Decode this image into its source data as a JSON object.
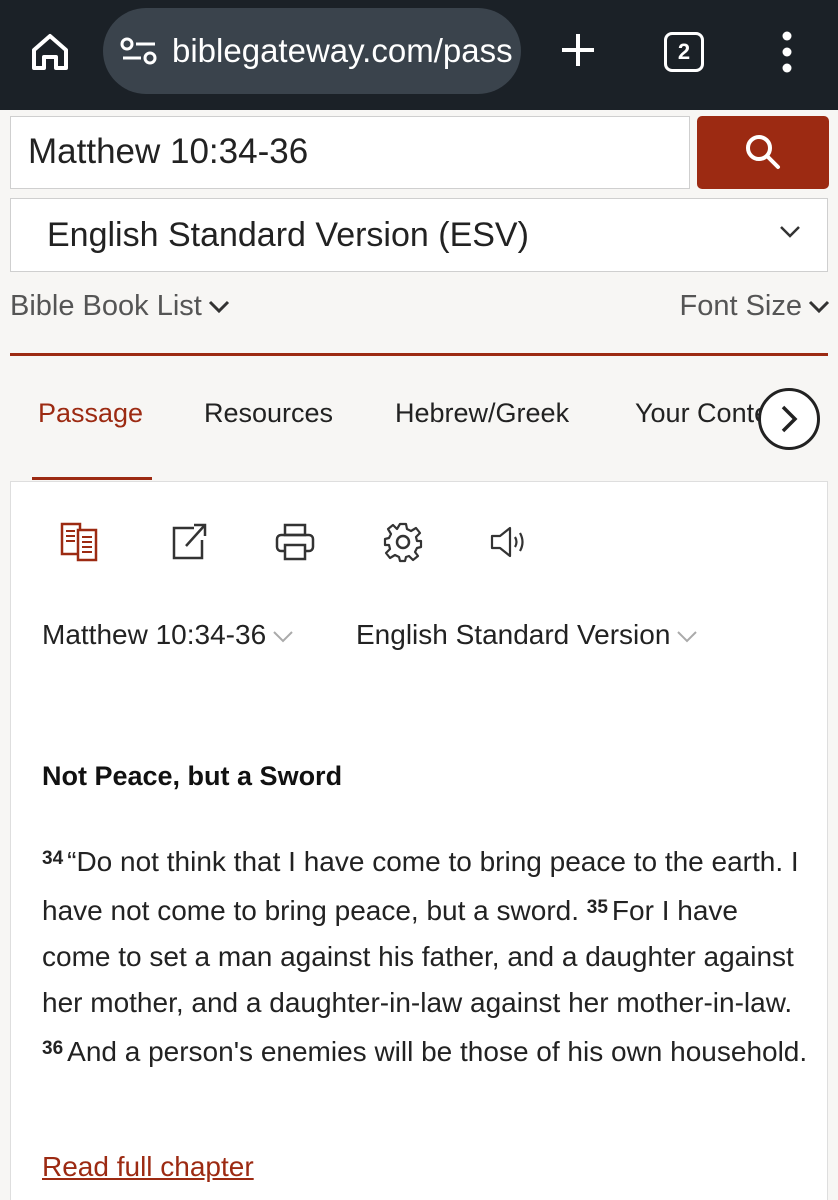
{
  "browser": {
    "url": "biblegateway.com/passage",
    "tab_count": "2",
    "icons": [
      "home-icon",
      "site-settings-icon",
      "plus-icon",
      "tab-switcher-icon",
      "more-menu-icon"
    ]
  },
  "search": {
    "query": "Matthew 10:34-36",
    "button_icon": "search-icon"
  },
  "version_select": {
    "selected": "English Standard Version (ESV)"
  },
  "nav": {
    "book_list_label": "Bible Book List",
    "font_size_label": "Font Size"
  },
  "tabs": [
    {
      "label": "Passage",
      "active": true
    },
    {
      "label": "Resources",
      "active": false
    },
    {
      "label": "Hebrew/Greek",
      "active": false
    },
    {
      "label": "Your Content",
      "active": false
    }
  ],
  "toolbar": {
    "icons": [
      "parallel-view-icon",
      "share-icon",
      "print-icon",
      "settings-icon",
      "audio-icon"
    ]
  },
  "passage_selector": {
    "reference": "Matthew 10:34-36",
    "version": "English Standard Version"
  },
  "passage": {
    "heading": "Not Peace, but a Sword",
    "verses": [
      {
        "num": "34",
        "text": "“Do not think that I have come to bring peace to the earth. I have not come to bring peace, but a sword."
      },
      {
        "num": "35",
        "text": "For I have come to set a man against his father, and a daughter against her mother, and a daughter-in-law against her mother-in-law."
      },
      {
        "num": "36",
        "text": "And a person's enemies will be those of his own household."
      }
    ],
    "read_full_chapter": "Read full chapter"
  },
  "colors": {
    "accent": "#9c2a12",
    "chrome": "#1b2127",
    "urlbar": "#3a434c"
  }
}
